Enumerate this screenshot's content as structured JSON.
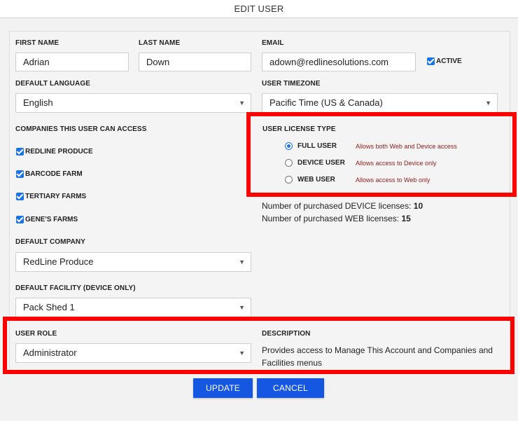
{
  "dialog": {
    "title": "EDIT USER"
  },
  "form": {
    "first_name": {
      "label": "FIRST NAME",
      "value": "Adrian"
    },
    "last_name": {
      "label": "LAST NAME",
      "value": "Down"
    },
    "email": {
      "label": "EMAIL",
      "value": "adown@redlinesolutions.com"
    },
    "active": {
      "label": "ACTIVE",
      "checked": true
    },
    "default_language": {
      "label": "DEFAULT LANGUAGE",
      "value": "English"
    },
    "user_timezone": {
      "label": "USER TIMEZONE",
      "value": "Pacific Time (US & Canada)"
    },
    "companies": {
      "label": "COMPANIES THIS USER CAN ACCESS",
      "items": [
        {
          "label": "REDLINE PRODUCE",
          "checked": true
        },
        {
          "label": "BARCODE FARM",
          "checked": true
        },
        {
          "label": "TERTIARY FARMS",
          "checked": true
        },
        {
          "label": "GENE'S FARMS",
          "checked": true
        }
      ]
    },
    "license_type": {
      "label": "USER LICENSE TYPE",
      "options": [
        {
          "label": "FULL USER",
          "desc": "Allows both Web and Device access",
          "selected": true
        },
        {
          "label": "DEVICE USER",
          "desc": "Allows access to Device only",
          "selected": false
        },
        {
          "label": "WEB USER",
          "desc": "Allows access to Web only",
          "selected": false
        }
      ]
    },
    "licenses": {
      "device_label": "Number of purchased DEVICE licenses:",
      "device_count": "10",
      "web_label": "Number of purchased WEB licenses:",
      "web_count": "15"
    },
    "default_company": {
      "label": "DEFAULT COMPANY",
      "value": "RedLine Produce"
    },
    "default_facility": {
      "label": "DEFAULT FACILITY (DEVICE ONLY)",
      "value": "Pack Shed 1"
    },
    "user_role": {
      "label": "USER ROLE",
      "value": "Administrator"
    },
    "description": {
      "label": "DESCRIPTION",
      "text": "Provides access to Manage This Account and Companies and Facilities menus"
    }
  },
  "buttons": {
    "update": "UPDATE",
    "cancel": "CANCEL"
  },
  "colors": {
    "highlight": "#ff0000",
    "button": "#1557e0",
    "checkbox": "#1a73e8",
    "radio_desc": "#8b1a1a"
  },
  "icons": {
    "dropdown": "chevron-down-icon",
    "checkbox": "checkbox-checked-icon"
  }
}
